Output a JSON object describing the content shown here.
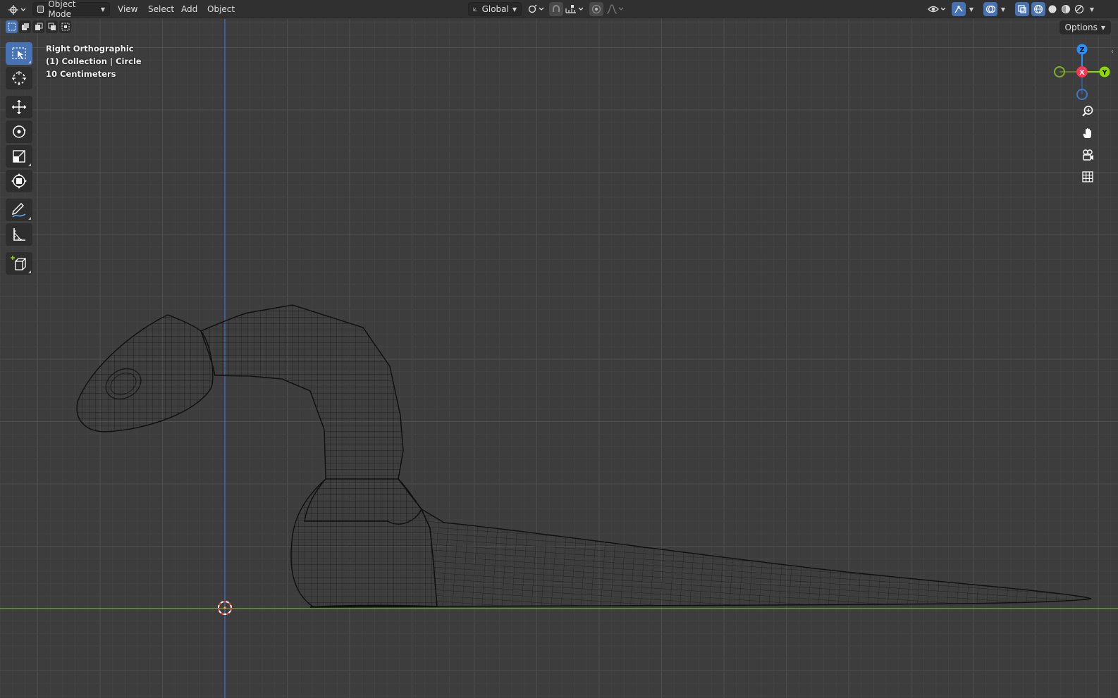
{
  "header": {
    "mode_label": "Object Mode",
    "menus": [
      "View",
      "Select",
      "Add",
      "Object"
    ],
    "orientation_label": "Global"
  },
  "options_label": "Options",
  "viewport": {
    "view_name": "Right Orthographic",
    "collection_info": "(1) Collection | Circle",
    "grid_scale": "10 Centimeters"
  },
  "gizmo": {
    "z": "Z",
    "x": "X",
    "y": "Y"
  },
  "colors": {
    "active_tool": "#4772b3",
    "axis_x": "#ff3352",
    "axis_y": "#8bdc00",
    "axis_z": "#2890ff",
    "background": "#3d3d3d"
  }
}
